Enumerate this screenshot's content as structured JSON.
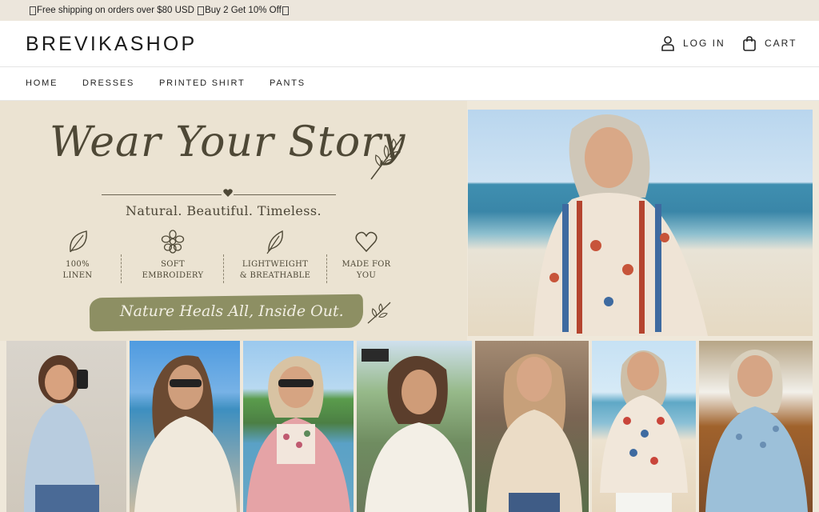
{
  "announcement": {
    "text": "Free shipping on orders over $80 USD",
    "text2": "Buy 2 Get 10% Off"
  },
  "header": {
    "logo": "BREVIKASHOP",
    "login_label": "LOG IN",
    "cart_label": "CART",
    "icons": [
      "user-icon",
      "shopping-bag-icon"
    ]
  },
  "nav": {
    "items": [
      {
        "label": "HOME"
      },
      {
        "label": "DRESSES"
      },
      {
        "label": "PRINTED SHIRT"
      },
      {
        "label": "PANTS"
      }
    ]
  },
  "hero": {
    "title": "Wear Your Story",
    "subtitle": "Natural. Beautiful. Timeless.",
    "features": [
      {
        "icon": "leaf-icon",
        "label": "100%\nLINEN"
      },
      {
        "icon": "flower-icon",
        "label": "SOFT\nEMBROIDERY"
      },
      {
        "icon": "feather-icon",
        "label": "LIGHTWEIGHT\n& BREATHABLE"
      },
      {
        "icon": "heart-icon",
        "label": "MADE FOR\nYOU"
      }
    ],
    "tagline": "Nature Heals All, Inside Out.",
    "colors": {
      "background": "#ebe3d2",
      "text": "#4e4836",
      "brush": "#8d8f63"
    }
  }
}
